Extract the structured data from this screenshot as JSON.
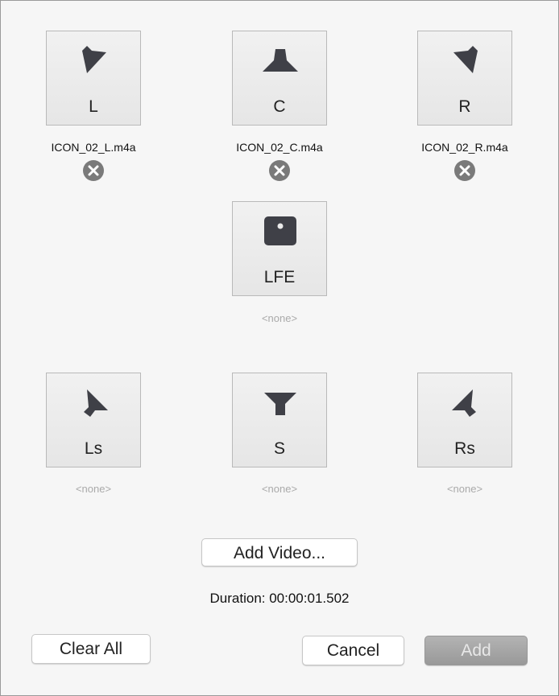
{
  "channels": [
    {
      "id": "L",
      "label": "L",
      "icon": "speaker-front-left-icon",
      "file": "ICON_02_L.m4a",
      "has_file": true
    },
    {
      "id": "C",
      "label": "C",
      "icon": "speaker-center-icon",
      "file": "ICON_02_C.m4a",
      "has_file": true
    },
    {
      "id": "R",
      "label": "R",
      "icon": "speaker-front-right-icon",
      "file": "ICON_02_R.m4a",
      "has_file": true
    },
    {
      "id": "LFE",
      "label": "LFE",
      "icon": "subwoofer-icon",
      "file": "<none>",
      "has_file": false
    },
    {
      "id": "Ls",
      "label": "Ls",
      "icon": "speaker-surround-left-icon",
      "file": "<none>",
      "has_file": false
    },
    {
      "id": "S",
      "label": "S",
      "icon": "speaker-surround-icon",
      "file": "<none>",
      "has_file": false
    },
    {
      "id": "Rs",
      "label": "Rs",
      "icon": "speaker-surround-right-icon",
      "file": "<none>",
      "has_file": false
    }
  ],
  "buttons": {
    "add_video": "Add Video...",
    "clear_all": "Clear All",
    "cancel": "Cancel",
    "add": "Add"
  },
  "duration": "Duration: 00:00:01.502",
  "colors": {
    "icon": "#3f4047",
    "remove": "#7a7a7a",
    "add_disabled": "#a6a6a6"
  }
}
